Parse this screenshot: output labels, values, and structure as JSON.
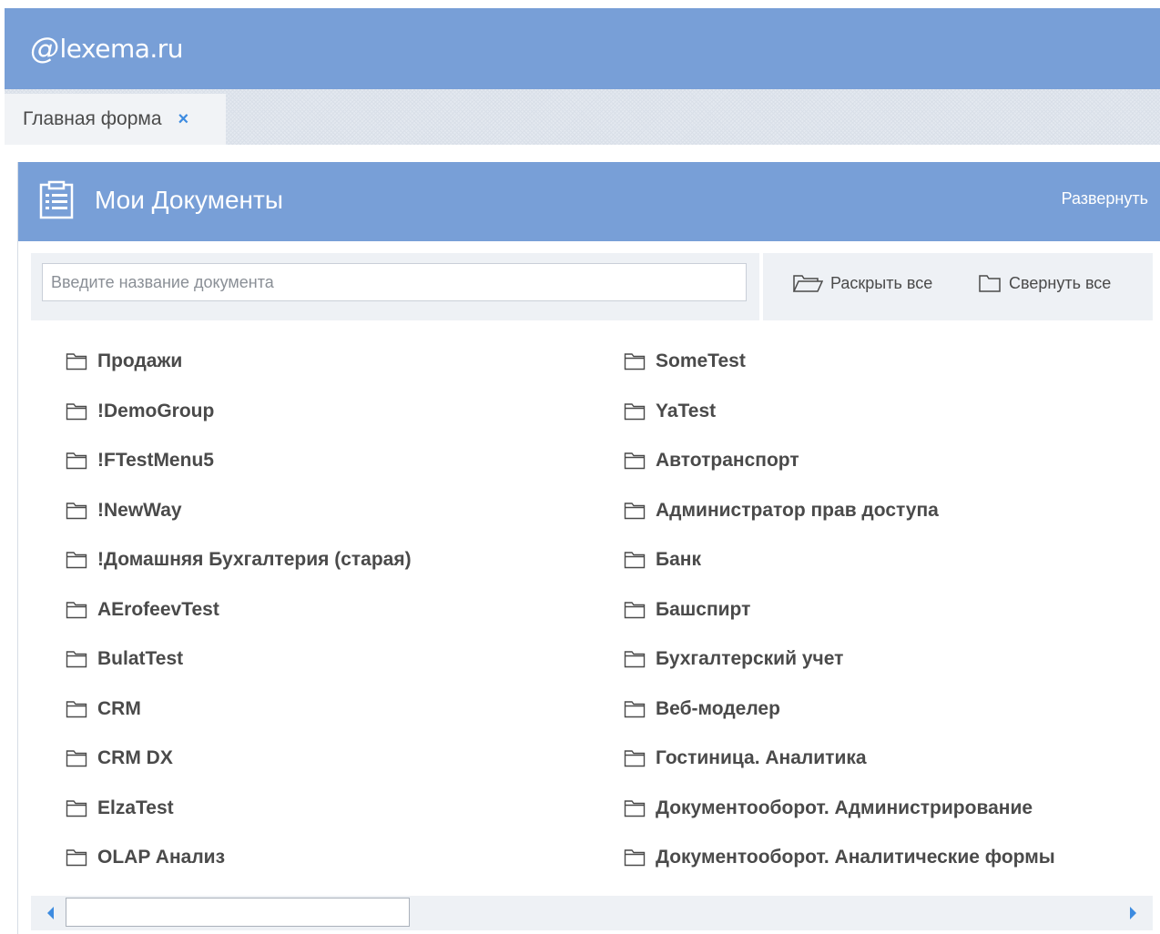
{
  "app": {
    "logo_mark": "@",
    "logo_text": "lexema.ru"
  },
  "tabs": [
    {
      "label": "Главная форма",
      "close": "×"
    }
  ],
  "panel": {
    "title": "Мои Документы",
    "expand_label": "Развернуть",
    "search": {
      "placeholder": "Введите название документа",
      "value": ""
    },
    "actions": {
      "expand_all": "Раскрыть все",
      "collapse_all": "Свернуть все"
    },
    "columns": [
      [
        "Продажи",
        "!DemoGroup",
        "!FTestMenu5",
        "!NewWay",
        "!Домашняя Бухгалтерия (старая)",
        "AErofeevTest",
        "BulatTest",
        "CRM",
        "CRM DX",
        "ElzaTest",
        "OLAP Анализ"
      ],
      [
        "SomeTest",
        "YaTest",
        "Автотранспорт",
        "Администратор прав доступа",
        "Банк",
        "Башспирт",
        "Бухгалтерский учет",
        "Веб-моделер",
        "Гостиница. Аналитика",
        "Документооборот. Администрирование",
        "Документооборот. Аналитические формы"
      ]
    ]
  },
  "icons": {
    "panel": "document-list-icon",
    "folder": "folder-icon",
    "expand_all": "folder-open-icon",
    "collapse_all": "folder-closed-icon"
  },
  "colors": {
    "header": "#789fd7",
    "accent": "#3d8be0",
    "text": "#4a4a4a"
  }
}
